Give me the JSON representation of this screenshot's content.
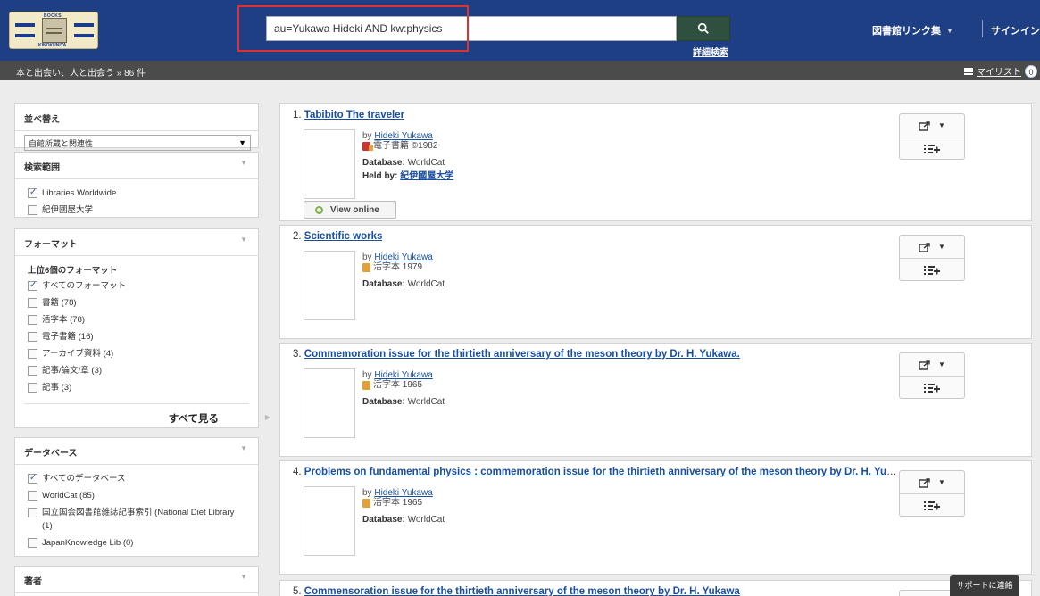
{
  "header": {
    "logo_top": "BOOKS",
    "logo_bottom": "KINOKUNIYA",
    "search_value": "au=Yukawa Hideki AND kw:physics",
    "advanced_search": "詳細検索",
    "library_links": "図書館リンク集",
    "signin": "サインイン"
  },
  "crumbbar": {
    "crumb": "本と出会い、人と出会う  »  86 件",
    "mylist": "マイリスト",
    "mylist_count": "0"
  },
  "sidebar": {
    "sort": {
      "title": "並べ替え",
      "selected": "自館所蔵と関連性"
    },
    "scope": {
      "title": "検索範囲",
      "items": [
        {
          "label": "Libraries Worldwide",
          "checked": true
        },
        {
          "label": "紀伊國屋大学",
          "checked": false
        }
      ]
    },
    "format": {
      "title": "フォーマット",
      "subhead": "上位6個のフォーマット",
      "items": [
        {
          "label": "すべてのフォーマット",
          "checked": true
        },
        {
          "label": "書籍 (78)",
          "checked": false
        },
        {
          "label": "活字本 (78)",
          "checked": false
        },
        {
          "label": "電子書籍 (16)",
          "checked": false
        },
        {
          "label": "アーカイブ資料 (4)",
          "checked": false
        },
        {
          "label": "記事/論文/章 (3)",
          "checked": false
        },
        {
          "label": "記事 (3)",
          "checked": false
        }
      ],
      "see_all": "すべて見る"
    },
    "database": {
      "title": "データベース",
      "items": [
        {
          "label": "すべてのデータベース",
          "checked": true
        },
        {
          "label": "WorldCat (85)",
          "checked": false
        },
        {
          "label": "国立国会図書館雑誌記事索引 (National Diet Library",
          "checked": false
        },
        {
          "label": "(1)",
          "checked": false
        },
        {
          "label": "JapanKnowledge Lib (0)",
          "checked": false
        }
      ]
    },
    "author": {
      "title": "著者"
    }
  },
  "results": [
    {
      "num": "1.",
      "title": "Tabibito The traveler",
      "by_prefix": "by",
      "author": "Hideki Yukawa",
      "format": "電子書籍 ©1982",
      "db_label": "Database:",
      "db": "WorldCat",
      "held_label": "Held by:",
      "held": "紀伊國屋大学",
      "view_online": "View online"
    },
    {
      "num": "2.",
      "title": "Scientific works",
      "by_prefix": "by",
      "author": "Hideki Yukawa",
      "format": "活字本 1979",
      "db_label": "Database:",
      "db": "WorldCat"
    },
    {
      "num": "3.",
      "title": "Commemoration issue for the thirtieth anniversary of the meson theory by Dr. H. Yukawa.",
      "by_prefix": "by",
      "author": "Hideki Yukawa",
      "format": "活字本 1965",
      "db_label": "Database:",
      "db": "WorldCat"
    },
    {
      "num": "4.",
      "title": "Problems on fundamental physics : commemoration issue for the thirtieth anniversary of the meson theory by Dr. H. Yuk...",
      "by_prefix": "by",
      "author": "Hideki Yukawa",
      "format": "活字本 1965",
      "db_label": "Database:",
      "db": "WorldCat"
    },
    {
      "num": "5.",
      "title": "Commensoration issue for the thirtieth anniversary of the meson theory by Dr. H. Yukawa"
    }
  ],
  "support": "サポートに連絡"
}
